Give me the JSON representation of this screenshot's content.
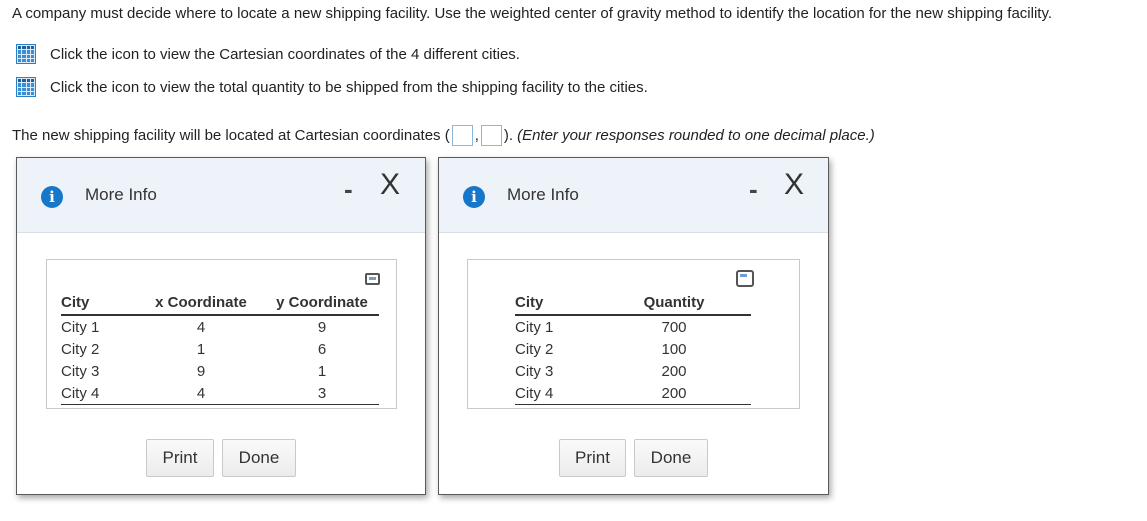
{
  "question": "A company must decide where to locate a new shipping facility. Use the weighted center of gravity method to identify the location for the new shipping facility.",
  "links": [
    {
      "text": "Click the icon to view the Cartesian coordinates of the 4 different cities.",
      "icon": "table-grid-icon"
    },
    {
      "text": "Click the icon to view the total quantity to be shipped from the shipping facility to the cities.",
      "icon": "table-grid-icon"
    }
  ],
  "answer": {
    "prefix": "The new shipping facility will be located at Cartesian coordinates (",
    "separator": ",",
    "suffix": ").",
    "hint": "(Enter your responses rounded to one decimal place.)",
    "x_value": "",
    "y_value": ""
  },
  "dialog_coordinates": {
    "title": "More Info",
    "minimize": "-",
    "close": "X",
    "headers": [
      "City",
      "x Coordinate",
      "y Coordinate"
    ],
    "rows": [
      [
        "City 1",
        "4",
        "9"
      ],
      [
        "City 2",
        "1",
        "6"
      ],
      [
        "City 3",
        "9",
        "1"
      ],
      [
        "City 4",
        "4",
        "3"
      ]
    ],
    "print_label": "Print",
    "done_label": "Done"
  },
  "dialog_quantity": {
    "title": "More Info",
    "minimize": "-",
    "close": "X",
    "headers": [
      "City",
      "Quantity"
    ],
    "rows": [
      [
        "City 1",
        "700"
      ],
      [
        "City 2",
        "100"
      ],
      [
        "City 3",
        "200"
      ],
      [
        "City 4",
        "200"
      ]
    ],
    "print_label": "Print",
    "done_label": "Done"
  },
  "colors": {
    "accent": "#1676c9",
    "dialog_header_bg": "#eef3f9",
    "icon_fill": "#3a8ed3"
  }
}
